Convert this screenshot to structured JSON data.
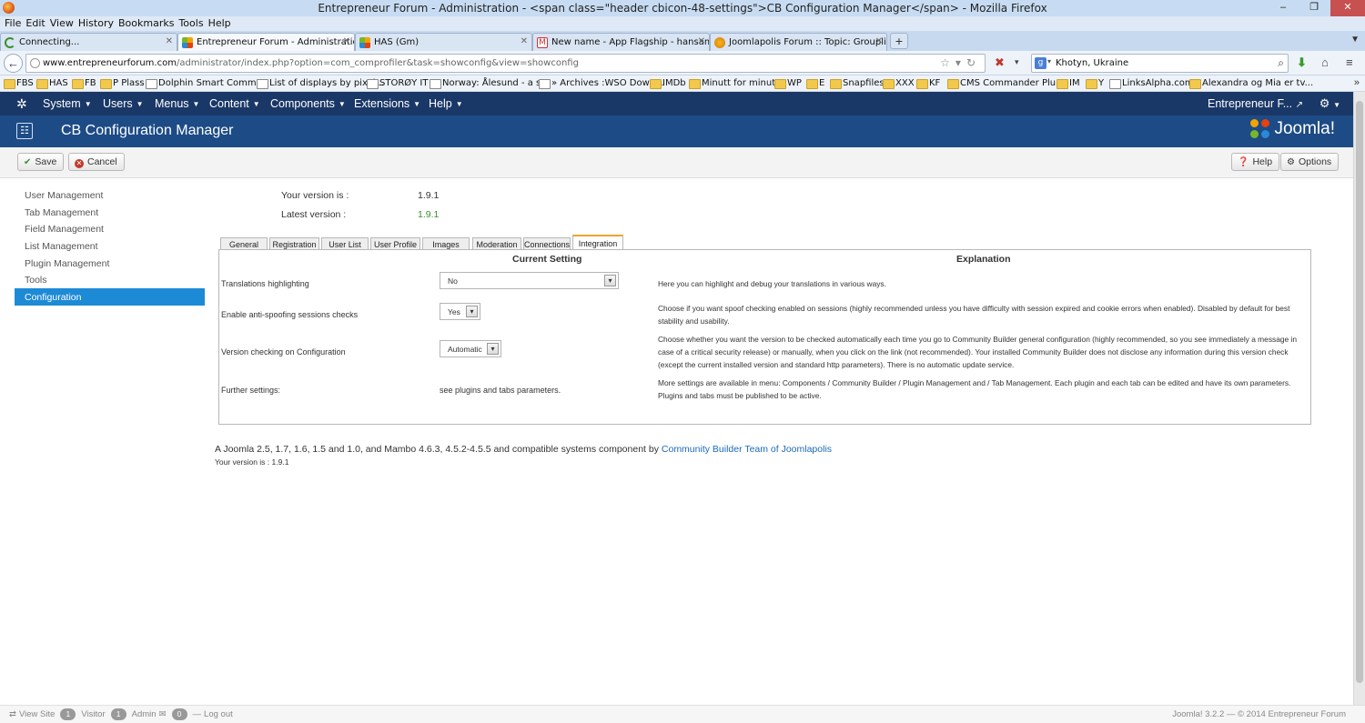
{
  "browser": {
    "window_title": "Entrepreneur Forum - Administration - <span class=\"header cbicon-48-settings\">CB Configuration Manager</span> - Mozilla Firefox",
    "menu": [
      "File",
      "Edit",
      "View",
      "History",
      "Bookmarks",
      "Tools",
      "Help"
    ],
    "tabs": [
      {
        "label": "Connecting...",
        "favicon": "spinner-icon"
      },
      {
        "label": "Entrepreneur Forum - Administration...",
        "favicon": "joomla-icon"
      },
      {
        "label": "HAS (Gm)",
        "favicon": "joomla-icon"
      },
      {
        "label": "New name - App Flagship - hansame...",
        "favicon": "gmail-icon"
      },
      {
        "label": "Joomlapolis Forum :: Topic: Grouplivi...",
        "favicon": "joomlapolis-icon"
      }
    ],
    "url_host": "www.entrepreneurforum.com",
    "url_path": "/administrator/index.php?option=com_comprofiler&task=showconfig&view=showconfig",
    "search_value": "Khotyn, Ukraine",
    "bookmarks": [
      "FBS",
      "HAS",
      "FB",
      "P Plass",
      "Dolphin Smart Comm...",
      "List of displays by pixel...",
      "STORØY IT",
      "Norway: Ålesund - a s...",
      "» Archives :WSO Down...",
      "IMDb",
      "Minutt for minutt",
      "WP",
      "E",
      "Snapfiles",
      "XXX",
      "KF",
      "CMS Commander Plu...",
      "IM",
      "Y",
      "LinksAlpha.com",
      "Alexandra og Mia er tv..."
    ]
  },
  "joomla_nav": {
    "menus": [
      "System",
      "Users",
      "Menus",
      "Content",
      "Components",
      "Extensions",
      "Help"
    ],
    "site_link": "Entrepreneur F..."
  },
  "header": {
    "title": "CB Configuration Manager",
    "brand": "Joomla!"
  },
  "toolbar": {
    "save": "Save",
    "cancel": "Cancel",
    "help": "Help",
    "options": "Options"
  },
  "sidebar": {
    "items": [
      "User Management",
      "Tab Management",
      "Field Management",
      "List Management",
      "Plugin Management",
      "Tools",
      "Configuration"
    ],
    "active": "Configuration"
  },
  "version": {
    "your_label": "Your version is :",
    "your_value": "1.9.1",
    "latest_label": "Latest version :",
    "latest_value": "1.9.1"
  },
  "tabs": [
    "General",
    "Registration",
    "User List",
    "User Profile",
    "Images",
    "Moderation",
    "Connections",
    "Integration"
  ],
  "active_tab": "Integration",
  "panel": {
    "col_current": "Current Setting",
    "col_explanation": "Explanation",
    "rows": [
      {
        "label": "Translations highlighting",
        "value": "No",
        "explanation": "Here you can highlight and debug your translations in various ways."
      },
      {
        "label": "Enable anti-spoofing sessions checks",
        "value": "Yes",
        "explanation": "Choose if you want spoof checking enabled on sessions (highly recommended unless you have difficulty with session expired and cookie errors when enabled). Disabled by default for best stability and usability."
      },
      {
        "label": "Version checking on Configuration",
        "value": "Automatic",
        "explanation": "Choose whether you want the version to be checked automatically each time you go to Community Builder general configuration (highly recommended, so you see immediately a message in case of a critical security release) or manually, when you click on the link (not recommended). Your installed Community Builder does not disclose any information during this version check (except the current installed version and standard http parameters). There is no automatic update service."
      },
      {
        "label": "Further settings:",
        "value": "see plugins and tabs parameters.",
        "explanation": "More settings are available in menu: Components / Community Builder / Plugin Management and / Tab Management. Each plugin and each tab can be edited and have its own parameters. Plugins and tabs must be published to be active."
      }
    ]
  },
  "footer": {
    "text": "A Joomla 2.5, 1.7, 1.6, 1.5 and 1.0, and Mambo 4.6.3, 4.5.2-4.5.5 and compatible systems component by",
    "link": "Community Builder Team of Joomlapolis",
    "version": "Your version is : 1.9.1"
  },
  "statusbar": {
    "view_site": "View Site",
    "visitors_count": "1",
    "visitor": "Visitor",
    "admins_count": "1",
    "admin": "Admin",
    "messages_count": "0",
    "logout": "Log out",
    "right": "Joomla! 3.2.2 — © 2014 Entrepreneur Forum"
  }
}
